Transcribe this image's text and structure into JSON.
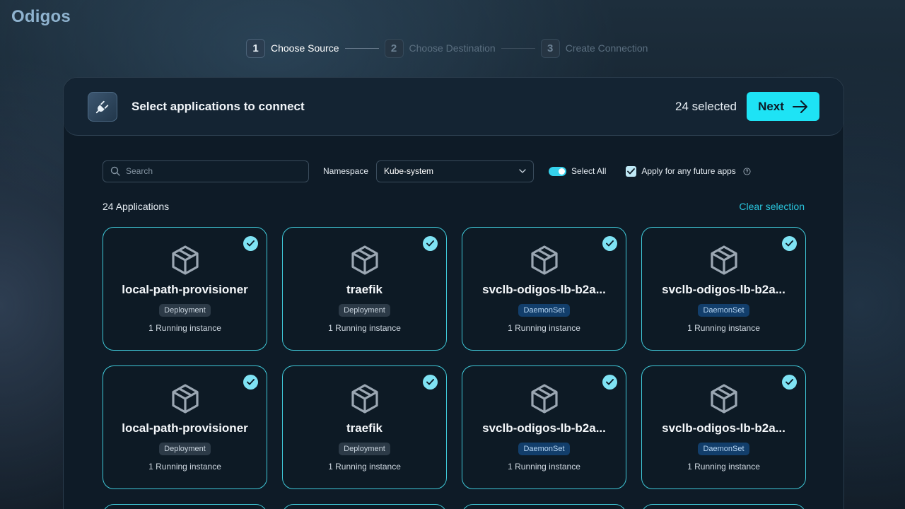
{
  "app": {
    "logo": "Odigos"
  },
  "stepper": [
    {
      "num": "1",
      "label": "Choose Source"
    },
    {
      "num": "2",
      "label": "Choose Destination"
    },
    {
      "num": "3",
      "label": "Create Connection"
    }
  ],
  "header": {
    "title": "Select applications to connect",
    "selected_count": "24 selected",
    "next_label": "Next"
  },
  "toolbar": {
    "search_placeholder": "Search",
    "namespace_label": "Namespace",
    "namespace_value": "Kube-system",
    "select_all_label": "Select All",
    "future_apps_label": "Apply for any future apps"
  },
  "list": {
    "count_label": "24 Applications",
    "clear_label": "Clear selection"
  },
  "cards": [
    {
      "name": "local-path-provisioner",
      "kind": "Deployment",
      "instances": "1 Running instance"
    },
    {
      "name": "traefik",
      "kind": "Deployment",
      "instances": "1 Running instance"
    },
    {
      "name": "svclb-odigos-lb-b2a...",
      "kind": "DaemonSet",
      "instances": "1 Running instance"
    },
    {
      "name": "svclb-odigos-lb-b2a...",
      "kind": "DaemonSet",
      "instances": "1 Running instance"
    },
    {
      "name": "local-path-provisioner",
      "kind": "Deployment",
      "instances": "1 Running instance"
    },
    {
      "name": "traefik",
      "kind": "Deployment",
      "instances": "1 Running instance"
    },
    {
      "name": "svclb-odigos-lb-b2a...",
      "kind": "DaemonSet",
      "instances": "1 Running instance"
    },
    {
      "name": "svclb-odigos-lb-b2a...",
      "kind": "DaemonSet",
      "instances": "1 Running instance"
    }
  ],
  "colors": {
    "accent": "#1ee3f5",
    "card_border": "#3fc8d8",
    "link": "#29c4dc"
  }
}
